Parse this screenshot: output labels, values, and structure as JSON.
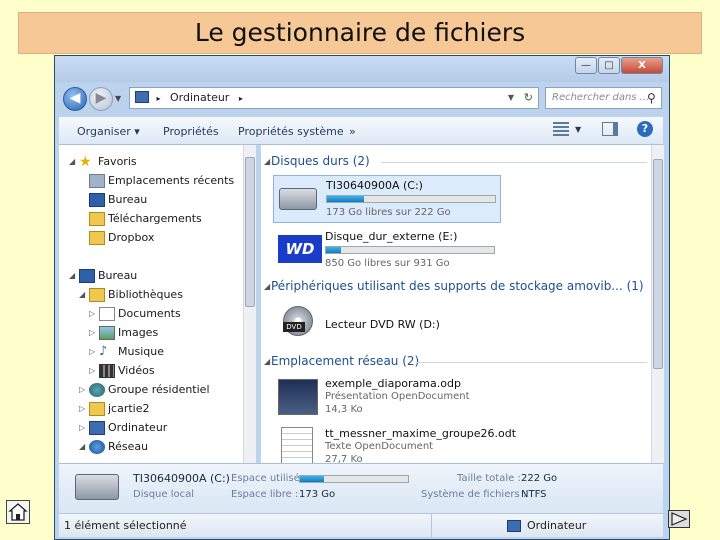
{
  "slide": {
    "title": "Le gestionnaire de fichiers"
  },
  "window": {
    "caption_buttons": {
      "minimize": "—",
      "maximize": "□",
      "close": "X"
    },
    "address": {
      "path_item": "Ordinateur",
      "separator": "▸",
      "search_placeholder": "Rechercher dans ..."
    },
    "toolbar": {
      "organize": "Organiser",
      "properties": "Propriétés",
      "system_properties": "Propriétés système",
      "more": "»"
    },
    "nav_tree": [
      {
        "label": "Favoris",
        "icon": "star-icon"
      },
      {
        "label": "Emplacements récents",
        "icon": "recent-places-icon"
      },
      {
        "label": "Bureau",
        "icon": "desktop-icon"
      },
      {
        "label": "Téléchargements",
        "icon": "downloads-folder-icon"
      },
      {
        "label": "Dropbox",
        "icon": "dropbox-folder-icon"
      },
      {
        "label": "Bureau",
        "icon": "desktop-icon"
      },
      {
        "label": "Bibliothèques",
        "icon": "libraries-icon"
      },
      {
        "label": "Documents",
        "icon": "documents-icon"
      },
      {
        "label": "Images",
        "icon": "pictures-icon"
      },
      {
        "label": "Musique",
        "icon": "music-icon"
      },
      {
        "label": "Vidéos",
        "icon": "videos-icon"
      },
      {
        "label": "Groupe résidentiel",
        "icon": "homegroup-icon"
      },
      {
        "label": "jcartie2",
        "icon": "user-folder-icon"
      },
      {
        "label": "Ordinateur",
        "icon": "computer-icon"
      },
      {
        "label": "Réseau",
        "icon": "network-icon"
      }
    ],
    "groups": {
      "hard_disks": "Disques durs (2)",
      "removable": "Périphériques utilisant des supports de stockage amovib... (1)",
      "network": "Emplacement réseau (2)"
    },
    "drives": [
      {
        "name": "TI30640900A (C:)",
        "free": "173 Go libres sur 222 Go",
        "used_fraction": 0.22
      },
      {
        "name": "Disque_dur_externe (E:)",
        "free": "850 Go libres sur 931 Go",
        "used_fraction": 0.09
      }
    ],
    "dvd": {
      "name": "Lecteur DVD RW (D:)",
      "badge": "DVD"
    },
    "wd_logo": "WD",
    "network_items": [
      {
        "name": "exemple_diaporama.odp",
        "type": "Présentation OpenDocument",
        "size": "14,3 Ko"
      },
      {
        "name": "tt_messner_maxime_groupe26.odt",
        "type": "Texte OpenDocument",
        "size": "27,7 Ko"
      }
    ],
    "details": {
      "drive_name": "TI30640900A (C:)",
      "drive_type": "Disque local",
      "used_label": "Espace utilisé :",
      "free_label": "Espace libre :",
      "free_value": "173 Go",
      "total_label": "Taille totale :",
      "total_value": "222 Go",
      "fs_label": "Système de fichiers :",
      "fs_value": "NTFS",
      "used_fraction": 0.22
    },
    "status": {
      "selected": "1 élément sélectionné",
      "location": "Ordinateur"
    }
  },
  "colors": {
    "slide_bg": "#ffffcc",
    "title_bg": "#f5c896",
    "link_blue": "#1e4f91"
  }
}
